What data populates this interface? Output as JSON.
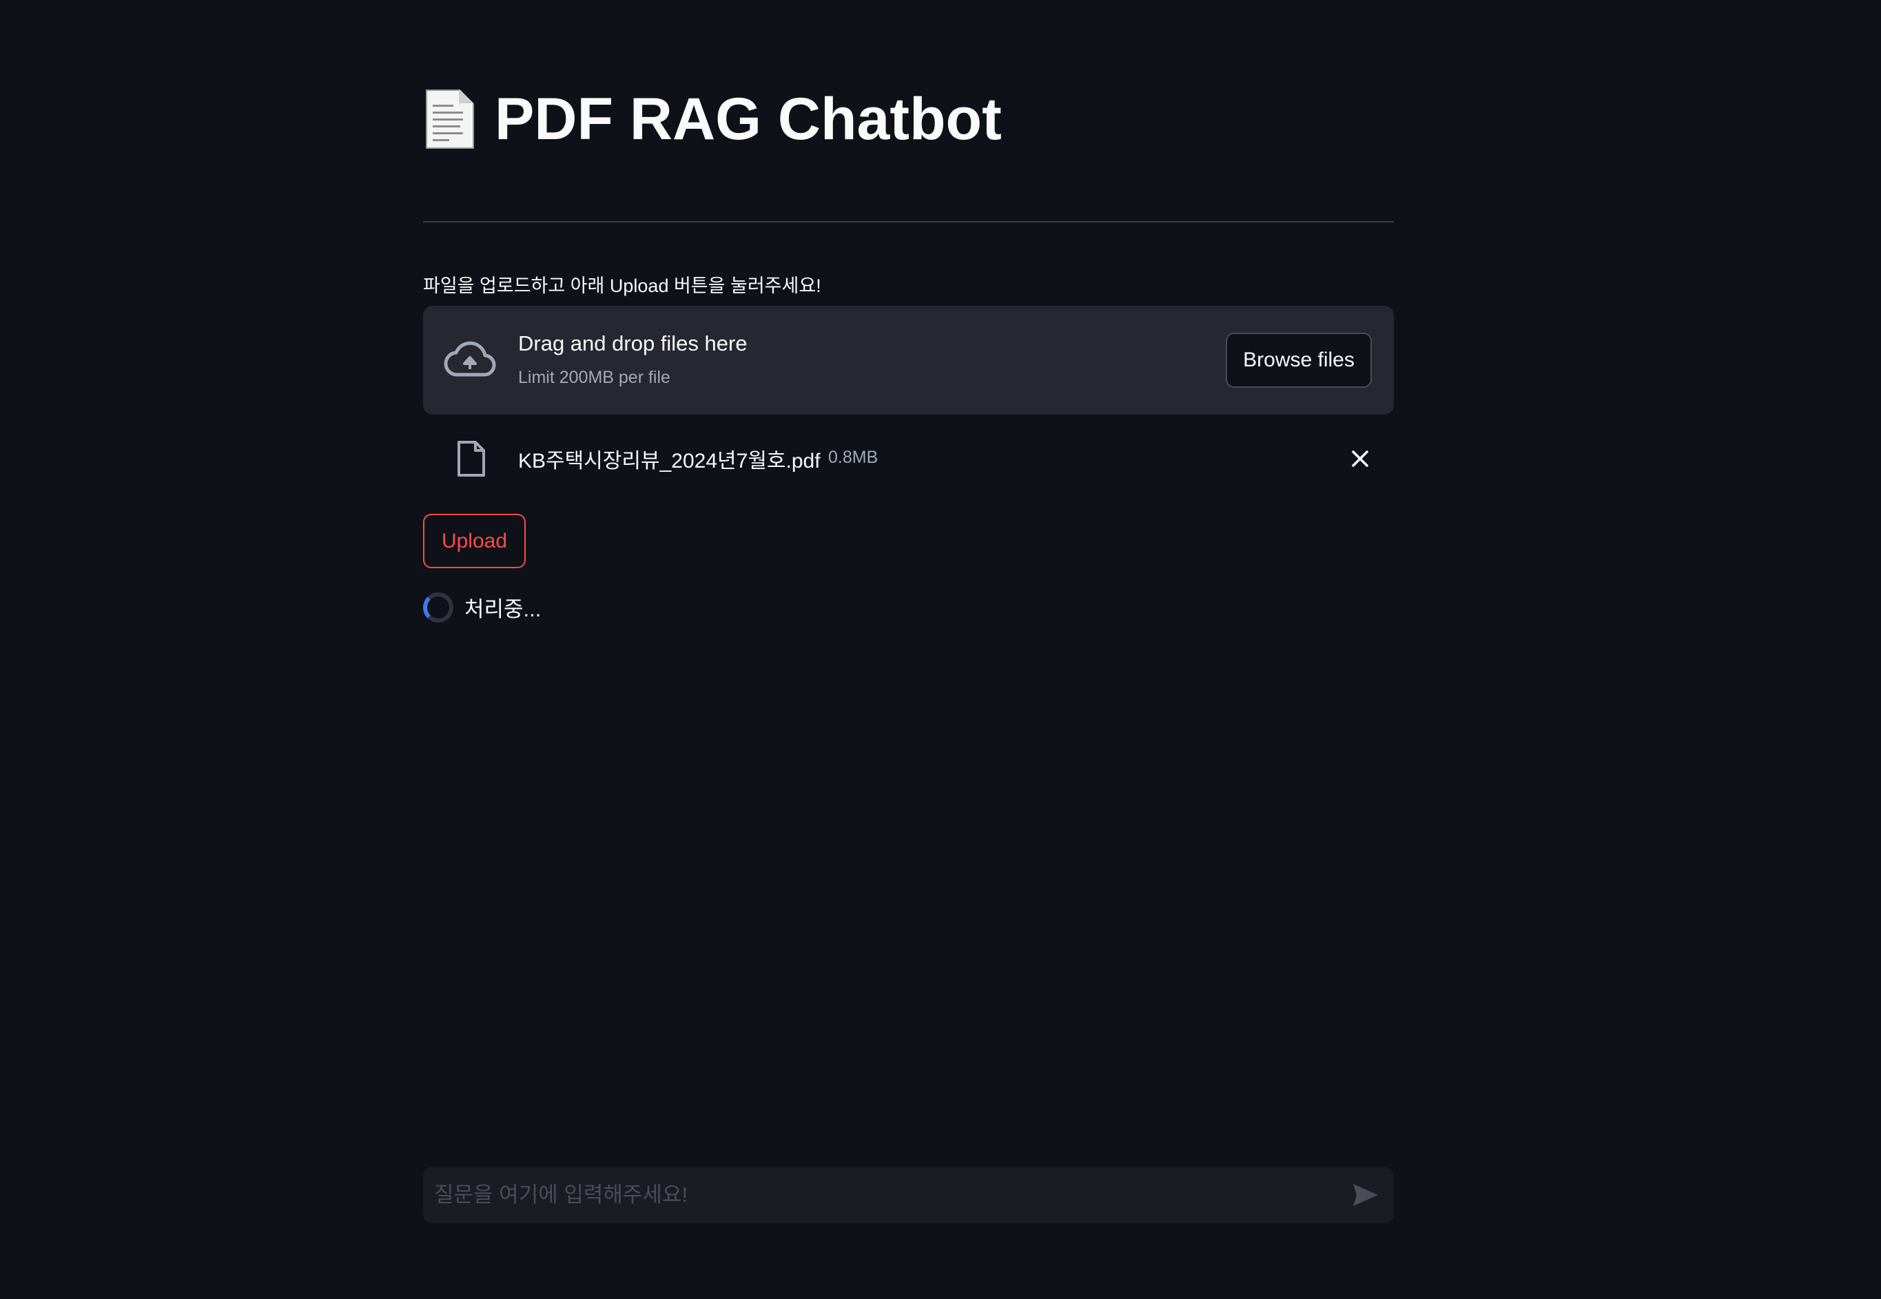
{
  "header": {
    "title_icon": "page-facing-up-icon",
    "title": "PDF RAG Chatbot"
  },
  "uploader": {
    "instruction": "파일을 업로드하고 아래 Upload 버튼을 눌러주세요!",
    "dropzone_title": "Drag and drop files here",
    "dropzone_limit": "Limit 200MB per file",
    "browse_label": "Browse files",
    "icon": "cloud-upload-icon"
  },
  "file": {
    "name": "KB주택시장리뷰_2024년7월호.pdf",
    "size": "0.8MB",
    "icon": "file-icon",
    "remove_icon": "close-icon"
  },
  "actions": {
    "upload_label": "Upload"
  },
  "status": {
    "text": "처리중..."
  },
  "chat": {
    "placeholder": "질문을 여기에 입력해주세요!",
    "value": "",
    "send_icon": "send-icon"
  },
  "colors": {
    "background": "#0e1117",
    "surface": "#262730",
    "accent": "#ff4b4b",
    "spinner": "#3d7bf0",
    "muted_text": "#a3a8b8"
  }
}
